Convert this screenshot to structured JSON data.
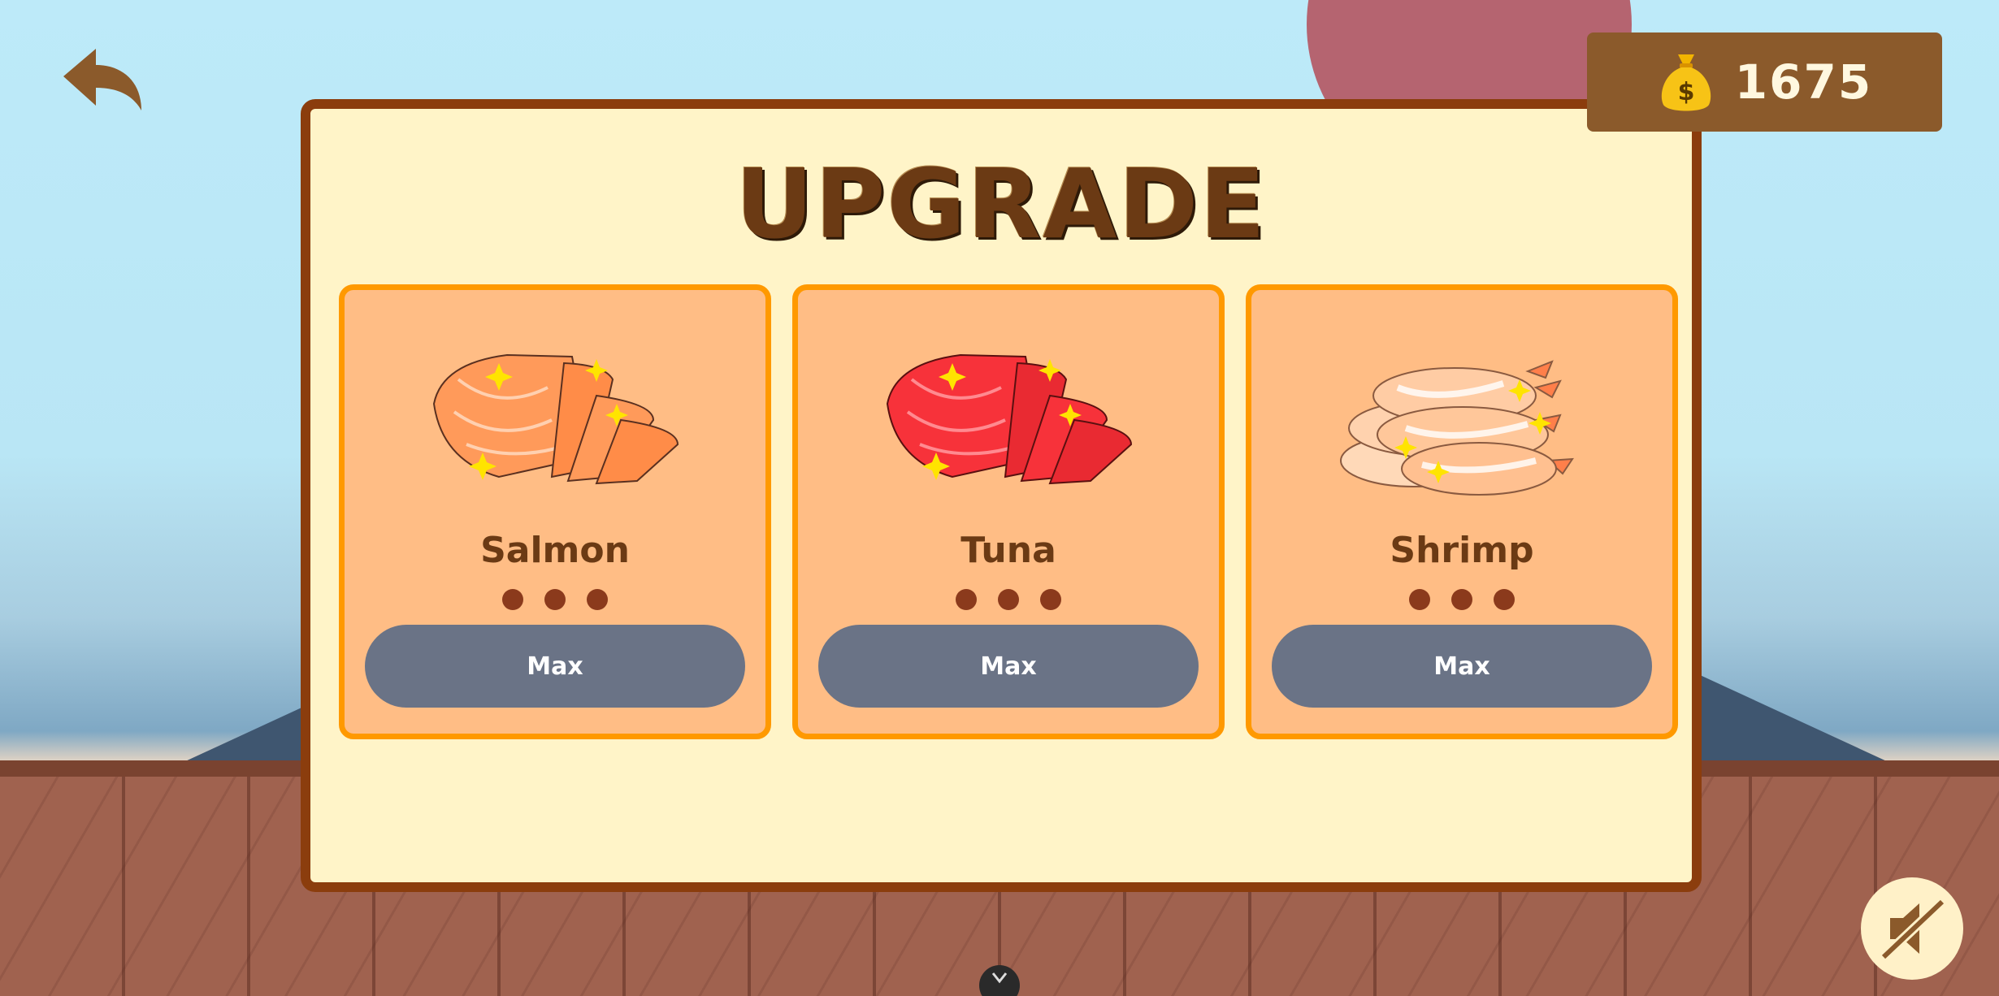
{
  "header": {
    "coins": "1675",
    "coin_icon": "money-bag-icon",
    "back_icon": "back-arrow-icon"
  },
  "panel": {
    "title": "UPGRADE"
  },
  "items": [
    {
      "name": "Salmon",
      "icon": "salmon-slices-icon",
      "level": 3,
      "max_level": 3,
      "button_label": "Max"
    },
    {
      "name": "Tuna",
      "icon": "tuna-slices-icon",
      "level": 3,
      "max_level": 3,
      "button_label": "Max"
    },
    {
      "name": "Shrimp",
      "icon": "shrimp-icon",
      "level": 3,
      "max_level": 3,
      "button_label": "Max"
    }
  ],
  "controls": {
    "mute_icon": "sound-off-icon",
    "bottom_tab_icon": "chevron-down-icon"
  },
  "colors": {
    "panel_bg": "#fff4c8",
    "panel_border": "#8b3d0d",
    "card_bg": "#ffbd85",
    "card_border": "#ff9900",
    "button_bg": "#6a7386",
    "coin_box_bg": "#8b5a2b",
    "level_dot": "#8b3a1c"
  }
}
